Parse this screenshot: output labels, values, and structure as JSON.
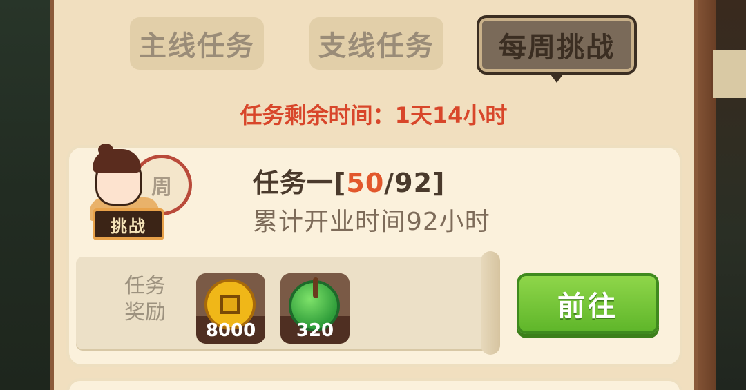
{
  "tabs": {
    "main": "主线任务",
    "side": "支线任务",
    "weekly": "每周挑战"
  },
  "timer": {
    "text": "任务剩余时间：1天14小时"
  },
  "task": {
    "title_prefix": "任务一[",
    "progress_current": "50",
    "progress_sep_total": "/92]",
    "description": "累计开业时间92小时",
    "badge": "挑战",
    "drum_char": "周",
    "reward_label_line1": "任务",
    "reward_label_line2": "奖励",
    "rewards": [
      {
        "icon": "gold-coin-icon",
        "count": "8000"
      },
      {
        "icon": "jade-pendant-icon",
        "count": "320"
      }
    ],
    "go_button": "前往"
  },
  "colors": {
    "timer": "#d8462a",
    "progress": "#e2572c",
    "button": "#6cc234"
  }
}
